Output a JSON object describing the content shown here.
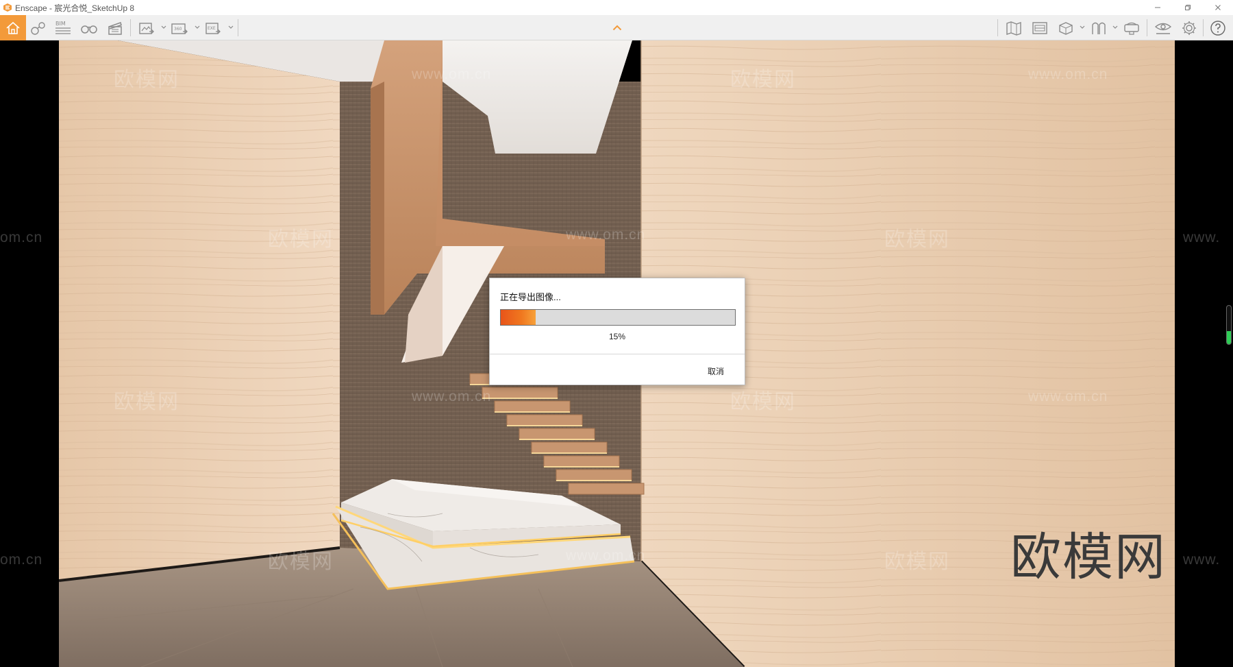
{
  "window": {
    "title": "Enscape - 宸光合悦_SketchUp 8",
    "minimize_icon": "minimize-icon",
    "restore_icon": "restore-icon",
    "close_icon": "close-icon"
  },
  "toolbar": {
    "left_icons": [
      "home-icon",
      "views-icon",
      "bim-icon",
      "binoculars-icon",
      "clapperboard-icon",
      "screenshot-export-icon",
      "panorama-360-export-icon",
      "exe-export-icon"
    ],
    "bim_label": "BIM",
    "export_360_label": "360",
    "export_exe_label": "EXE",
    "right_icons": [
      "map-icon",
      "batch-render-icon",
      "asset-library-icon",
      "material-editor-icon",
      "vr-headset-icon",
      "visual-settings-icon",
      "settings-icon",
      "help-icon"
    ],
    "accent": "#f39a3a"
  },
  "watermark": {
    "text": "欧模网",
    "url": "www.om.cn",
    "url_partial_left": "om.cn",
    "url_partial_right": "www."
  },
  "dialog": {
    "title": "正在导出图像...",
    "progress": 0.15,
    "progress_label": "15%",
    "cancel_label": "取消",
    "progress_color": "#ef6a1f"
  },
  "side_indicator": {
    "level": 0.34,
    "color": "#2ecc55"
  }
}
